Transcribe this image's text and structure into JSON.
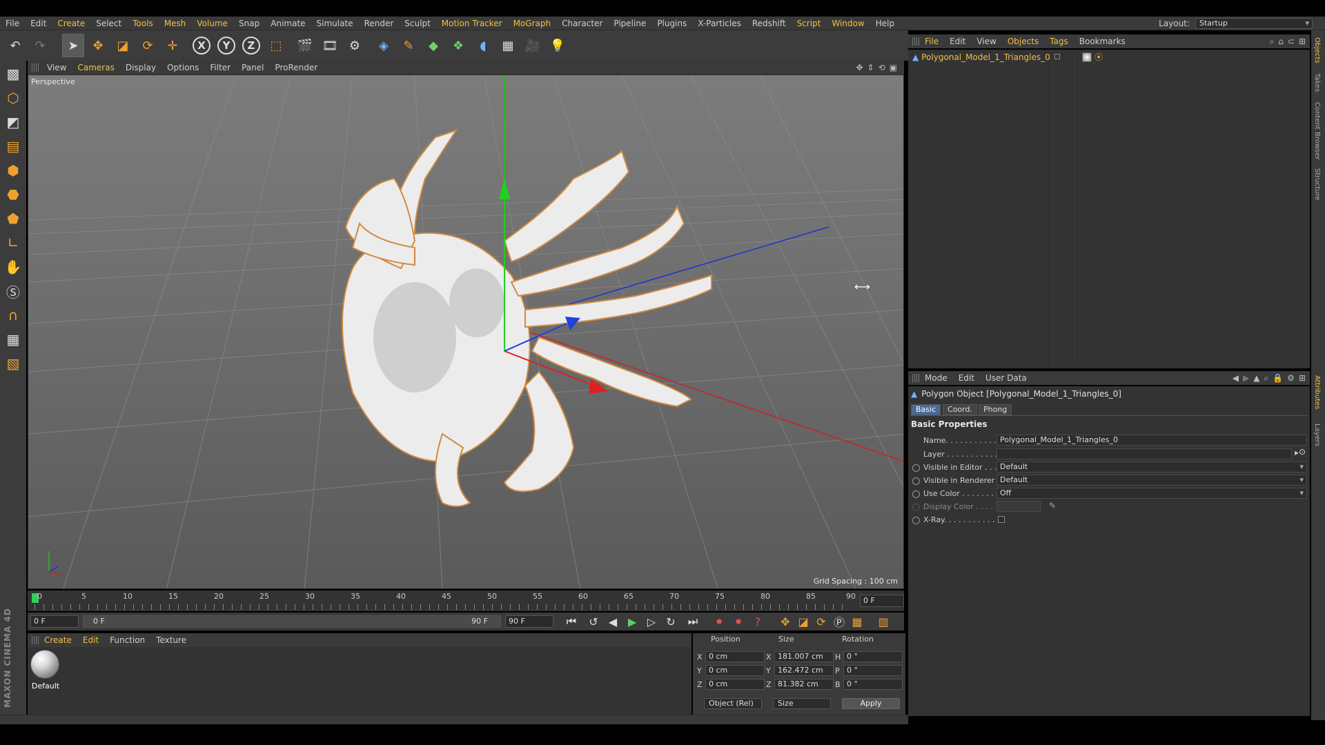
{
  "menu": {
    "items": [
      "File",
      "Edit",
      "Create",
      "Select",
      "Tools",
      "Mesh",
      "Volume",
      "Snap",
      "Animate",
      "Simulate",
      "Render",
      "Sculpt",
      "Motion Tracker",
      "MoGraph",
      "Character",
      "Pipeline",
      "Plugins",
      "X-Particles",
      "Redshift",
      "Script",
      "Window",
      "Help"
    ],
    "highlighted": [
      "Create",
      "Tools",
      "Mesh",
      "Volume",
      "Motion Tracker",
      "MoGraph",
      "Script",
      "Window"
    ],
    "layout_label": "Layout:",
    "layout_value": "Startup"
  },
  "viewport": {
    "menu": [
      "View",
      "Cameras",
      "Display",
      "Options",
      "Filter",
      "Panel",
      "ProRender"
    ],
    "label": "Perspective",
    "grid_spacing": "Grid Spacing : 100 cm"
  },
  "timeline": {
    "ticks": [
      "0",
      "5",
      "10",
      "15",
      "20",
      "25",
      "30",
      "35",
      "40",
      "45",
      "50",
      "55",
      "60",
      "65",
      "70",
      "75",
      "80",
      "85",
      "90"
    ],
    "current_frame": "0 F",
    "start_field": "0 F",
    "range_start": "0 F",
    "range_end": "90 F",
    "end_field": "90 F"
  },
  "material": {
    "menu": [
      "Create",
      "Edit",
      "Function",
      "Texture"
    ],
    "name": "Default"
  },
  "coordinates": {
    "headers": [
      "Position",
      "Size",
      "Rotation"
    ],
    "rows": [
      {
        "axis": "X",
        "pos": "0 cm",
        "size_label": "X",
        "size": "181.007 cm",
        "rot_label": "H",
        "rot": "0 °"
      },
      {
        "axis": "Y",
        "pos": "0 cm",
        "size_label": "Y",
        "size": "162.472 cm",
        "rot_label": "P",
        "rot": "0 °"
      },
      {
        "axis": "Z",
        "pos": "0 cm",
        "size_label": "Z",
        "size": "81.382 cm",
        "rot_label": "B",
        "rot": "0 °"
      }
    ],
    "mode": "Object (Rel)",
    "size_mode": "Size",
    "apply": "Apply"
  },
  "objects": {
    "menu": [
      "File",
      "Edit",
      "View",
      "Objects",
      "Tags",
      "Bookmarks"
    ],
    "highlighted": [
      "File",
      "Objects",
      "Tags"
    ],
    "items": [
      "Polygonal_Model_1_Triangles_0"
    ]
  },
  "attributes": {
    "menu": [
      "Mode",
      "Edit",
      "User Data"
    ],
    "title": "Polygon Object [Polygonal_Model_1_Triangles_0]",
    "tabs": [
      "Basic",
      "Coord.",
      "Phong"
    ],
    "section": "Basic Properties",
    "name_label": "Name. . . . . . . . . . . . .",
    "name_value": "Polygonal_Model_1_Triangles_0",
    "layer_label": "Layer . . . . . . . . . . . . .",
    "visible_editor_label": "Visible in Editor . . .",
    "visible_editor_value": "Default",
    "visible_renderer_label": "Visible in Renderer",
    "visible_renderer_value": "Default",
    "use_color_label": "Use Color . . . . . . . .",
    "use_color_value": "Off",
    "display_color_label": "Display Color . . . .",
    "xray_label": "X-Ray. . . . . . . . . . . ."
  },
  "side_tabs": [
    "Objects",
    "Takes",
    "Content Browser",
    "Structure",
    "Attributes",
    "Layers"
  ],
  "brand": "MAXON CINEMA 4D",
  "colors": {
    "accent": "#f0c040",
    "axis_x": "#e02020",
    "axis_y": "#20d020",
    "axis_z": "#2040e0"
  }
}
